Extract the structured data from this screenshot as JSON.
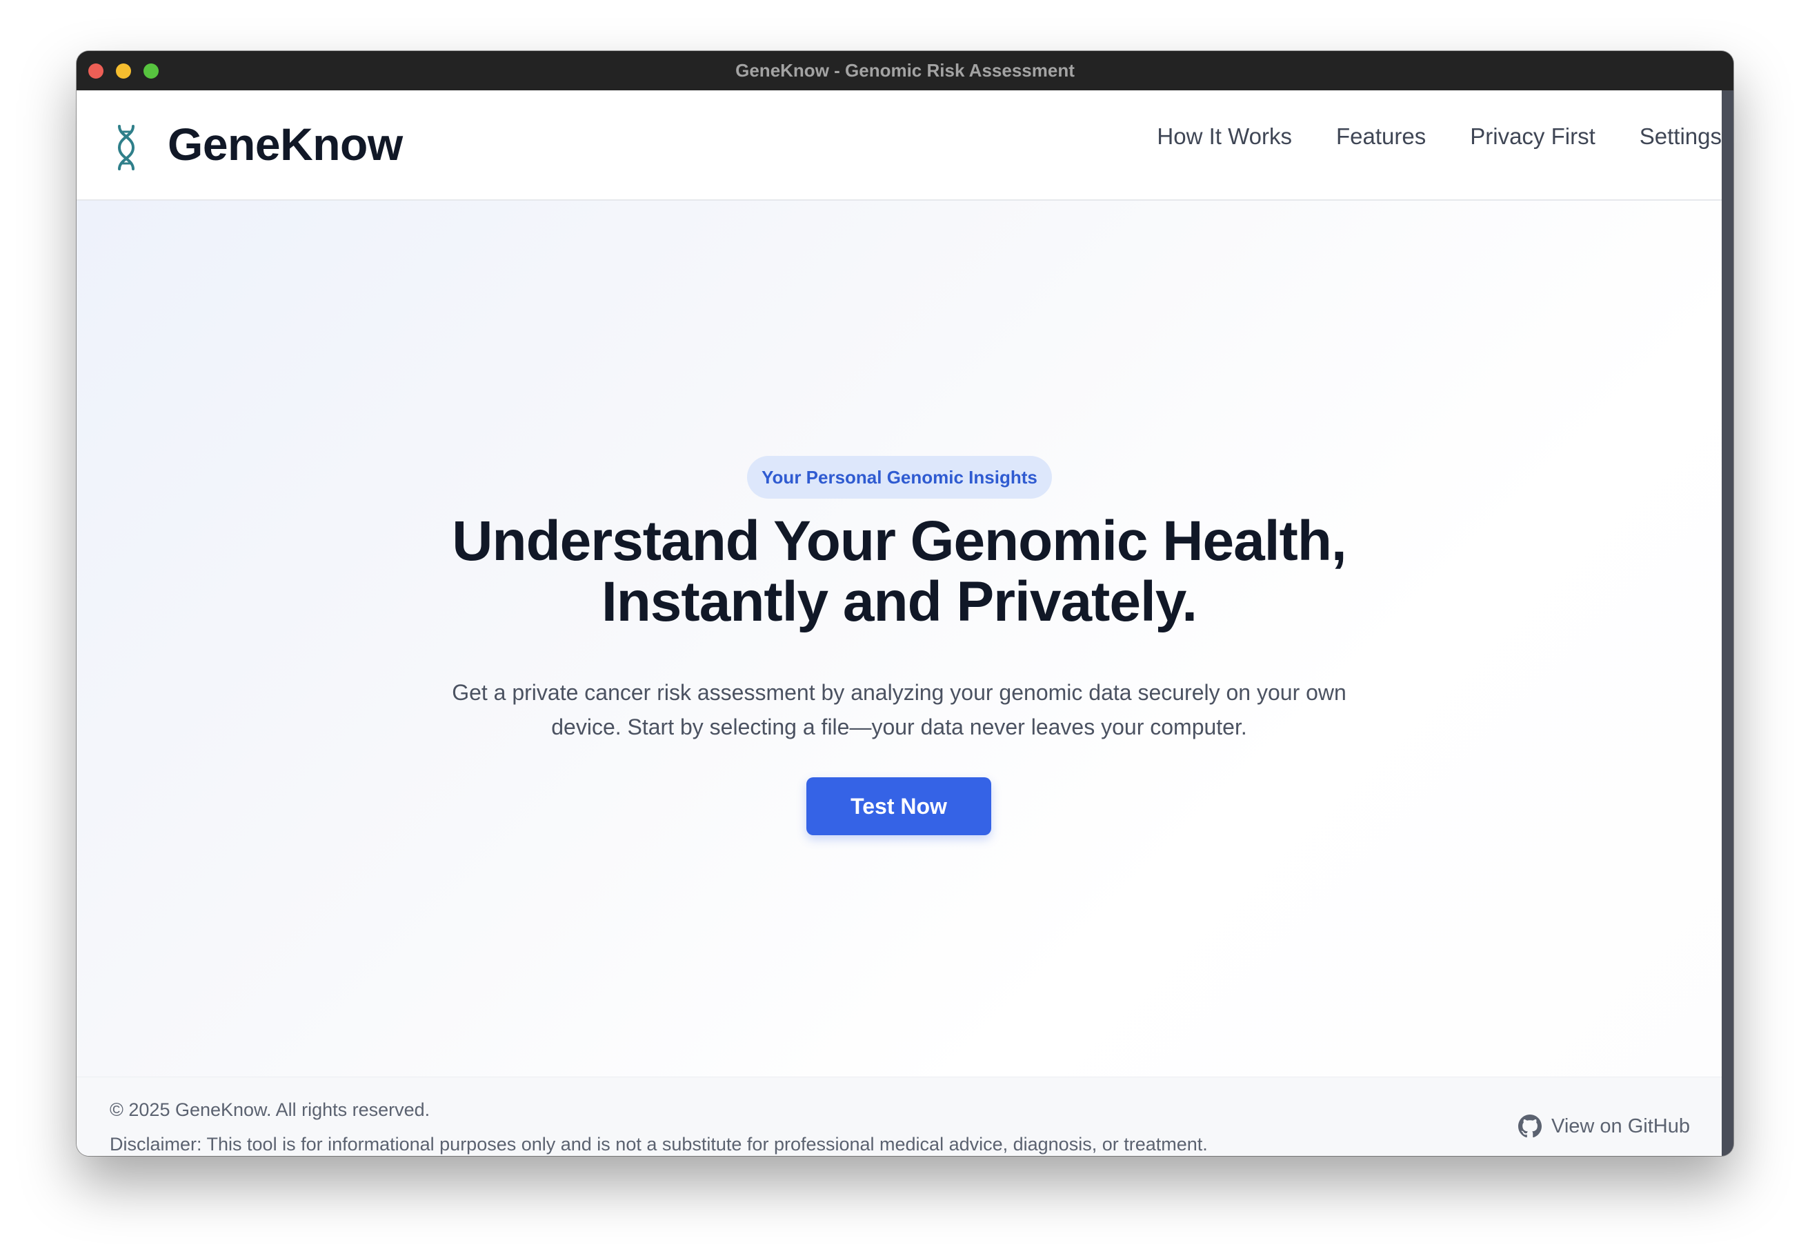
{
  "window": {
    "title": "GeneKnow - Genomic Risk Assessment"
  },
  "header": {
    "brand": "GeneKnow",
    "logo_icon": "dna-icon",
    "nav": [
      {
        "label": "How It Works"
      },
      {
        "label": "Features"
      },
      {
        "label": "Privacy First"
      },
      {
        "label": "Settings"
      }
    ]
  },
  "hero": {
    "badge": "Your Personal Genomic Insights",
    "headline_line1": "Understand Your Genomic Health,",
    "headline_line2": "Instantly and Privately.",
    "subtext_line1": "Get a private cancer risk assessment by analyzing your genomic data securely on your own",
    "subtext_line2": "device. Start by selecting a file—your data never leaves your computer.",
    "cta_label": "Test Now"
  },
  "footer": {
    "copyright": "© 2025 GeneKnow. All rights reserved.",
    "disclaimer": "Disclaimer: This tool is for informational purposes only and is not a substitute for professional medical advice, diagnosis, or treatment.",
    "github_icon": "github-icon",
    "github_label": "View on GitHub"
  },
  "colors": {
    "accent": "#3563e6",
    "badge_bg": "#dde7fb",
    "badge_text": "#2f5bd1",
    "logo": "#2f7f8a",
    "heading": "#111827"
  }
}
